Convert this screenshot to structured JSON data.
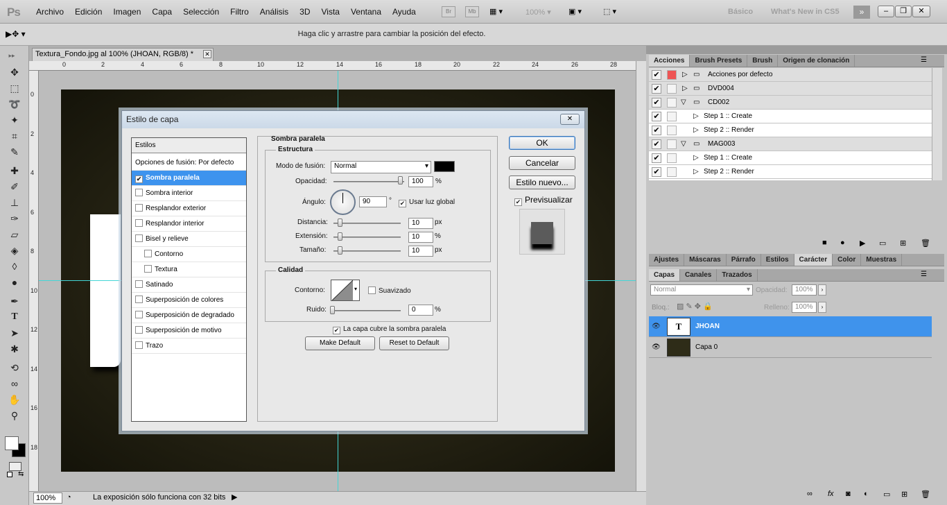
{
  "menubar": {
    "logo": "Ps",
    "items": [
      "Archivo",
      "Edición",
      "Imagen",
      "Capa",
      "Selección",
      "Filtro",
      "Análisis",
      "3D",
      "Vista",
      "Ventana",
      "Ayuda"
    ],
    "br": "Br",
    "mb": "Mb",
    "zoom": "100%",
    "workspace_basic": "Básico",
    "workspace_new": "What's New in CS5"
  },
  "options": {
    "message": "Haga clic y arrastre para cambiar la posición del efecto."
  },
  "document": {
    "tab_title": "Textura_Fondo.jpg al 100% (JHOAN, RGB/8) *",
    "ruler_top": [
      "0",
      "2",
      "4",
      "6",
      "8",
      "10",
      "12",
      "14",
      "16",
      "18",
      "20",
      "22",
      "24",
      "26",
      "28"
    ],
    "ruler_left": [
      "0",
      "2",
      "4",
      "6",
      "8",
      "10",
      "12",
      "14",
      "16",
      "18"
    ],
    "zoom": "100%",
    "status": "La exposición sólo funciona con 32 bits"
  },
  "actions_panel": {
    "tabs": [
      "Acciones",
      "Brush Presets",
      "Brush",
      "Origen de clonación"
    ],
    "rows": [
      {
        "label": "Acciones por defecto",
        "type": "set"
      },
      {
        "label": "DVD004",
        "type": "set"
      },
      {
        "label": "CD002",
        "type": "set"
      },
      {
        "label": "Step 1 :: Create",
        "type": "step"
      },
      {
        "label": "Step 2 :: Render",
        "type": "step"
      },
      {
        "label": "MAG003",
        "type": "set"
      },
      {
        "label": "Step 1 :: Create",
        "type": "step"
      },
      {
        "label": "Step 2 :: Render",
        "type": "step"
      }
    ]
  },
  "char_panel": {
    "tabs": [
      "Ajustes",
      "Máscaras",
      "Párrafo",
      "Estilos",
      "Carácter",
      "Color",
      "Muestras"
    ]
  },
  "layers_panel": {
    "tabs": [
      "Capas",
      "Canales",
      "Trazados"
    ],
    "blend_mode": "Normal",
    "opacity_label": "Opacidad:",
    "opacity_value": "100%",
    "lock_label": "Bloq.:",
    "fill_label": "Relleno:",
    "fill_value": "100%",
    "layers": [
      {
        "name": "JHOAN",
        "thumb": "T"
      },
      {
        "name": "Capa 0"
      }
    ]
  },
  "dialog": {
    "title": "Estilo de capa",
    "close": "✕",
    "styles_header": "Estilos",
    "blend_options": "Opciones de fusión: Por defecto",
    "styles": [
      {
        "label": "Sombra paralela",
        "checked": true
      },
      {
        "label": "Sombra interior"
      },
      {
        "label": "Resplandor exterior"
      },
      {
        "label": "Resplandor interior"
      },
      {
        "label": "Bisel y relieve"
      },
      {
        "label": "Contorno"
      },
      {
        "label": "Textura"
      },
      {
        "label": "Satinado"
      },
      {
        "label": "Superposición de colores"
      },
      {
        "label": "Superposición de degradado"
      },
      {
        "label": "Superposición de motivo"
      },
      {
        "label": "Trazo"
      }
    ],
    "section_title": "Sombra paralela",
    "structure_title": "Estructura",
    "blend_label": "Modo de fusión:",
    "blend_value": "Normal",
    "shadow_color": "#000000",
    "opacity_label": "Opacidad:",
    "opacity_value": "100",
    "angle_label": "Ángulo:",
    "angle_value": "90",
    "degree_unit": "°",
    "global_light": "Usar luz global",
    "distance_label": "Distancia:",
    "distance_value": "10",
    "spread_label": "Extensión:",
    "spread_value": "10",
    "size_label": "Tamaño:",
    "size_value": "10",
    "unit_px": "px",
    "unit_pct": "%",
    "quality_title": "Calidad",
    "contour_label": "Contorno:",
    "antialias": "Suavizado",
    "noise_label": "Ruido:",
    "noise_value": "0",
    "knockout": "La capa cubre la sombra paralela",
    "make_default": "Make Default",
    "reset_default": "Reset to Default",
    "ok": "OK",
    "cancel": "Cancelar",
    "new_style": "Estilo nuevo...",
    "preview": "Previsualizar",
    "accent": "#3d93ee"
  }
}
